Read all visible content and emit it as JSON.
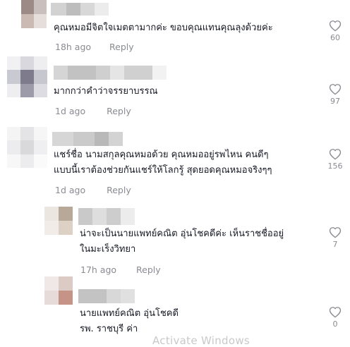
{
  "comments": [
    {
      "text": "คุณหมอมีจิตใจเมตตามากค่ะ ขอบคุณแทนคุณลุงด้วยค่ะ",
      "time": "18h ago",
      "reply_label": "Reply",
      "likes": "60",
      "avatar_colors": [
        "#9b8a86",
        "#c9bfbd",
        "#cbbab4",
        "#e6dedb"
      ],
      "name_blur_colors": [
        "#d2d2d2",
        "#bdbdbd",
        "#d8d8d8",
        "#ececec"
      ]
    },
    {
      "text": "มากกว่าคำว่าจรรยาบรรณ",
      "time": "1d ago",
      "reply_label": "Reply",
      "likes": "97",
      "avatar_colors": [
        "#f1f1f3",
        "#d8d8de",
        "#eeeef0",
        "#c9c9d1",
        "#7d7b8c",
        "#c7c7cf",
        "#eeeef1",
        "#9d9ba9",
        "#dcdce2"
      ],
      "name_blur_colors": [
        "#d5d5d5",
        "#c2c2c2",
        "#cfcfcf",
        "#e5e5e5",
        "#d0d0d0",
        "#f2f2f2"
      ]
    },
    {
      "text": "แชร์ชื่อ นามสกุลคุณหมอด้วย คุณหมออยู่รพไหน คนดีๆ\nแบบนี้เราต้องช่วยกันแชร์ให้โลกรู้ สุดยอดคุณหมอจริงๆๆ",
      "time": "1d ago",
      "reply_label": "Reply",
      "likes": "156",
      "avatar_colors": [
        "#f4f4f5",
        "#e4e4e6",
        "#f6f6f7",
        "#ececee",
        "#d9d9dc",
        "#efeff1",
        "#f7f7f8",
        "#ececee",
        "#fafafa"
      ],
      "name_blur_colors": [
        "#d6d6d6",
        "#cacaca",
        "#b9b9b9",
        "#d3d3d3"
      ]
    },
    {
      "text": "น่าจะเป็นนายแพทย์คณิต อุ่นโชคดีค่ะ เห็นราชชื่ออยู่\nในมะเร็งวิทยา",
      "time": "17h ago",
      "reply_label": "Reply",
      "likes": "7",
      "avatar_colors": [
        "#ece6e1",
        "#b8a898",
        "#f1ece8",
        "#ddd1c6"
      ],
      "name_blur_colors": [
        "#c9c9c9",
        "#dedede",
        "#cdcdcd",
        "#ececec"
      ]
    },
    {
      "text": "นายแพทย์คณิต อุ่นโชคดี\nรพ. ราชบุรี ค่า",
      "time": "",
      "reply_label": "",
      "likes": "0",
      "avatar_colors": [
        "#f0e8e6",
        "#dccac5",
        "#e6dbd8",
        "#c59487"
      ],
      "name_blur_colors": [
        "#c3c3c3",
        "#d8d8d8",
        "#e0e0e0"
      ]
    }
  ],
  "watermark": "Activate Windows"
}
